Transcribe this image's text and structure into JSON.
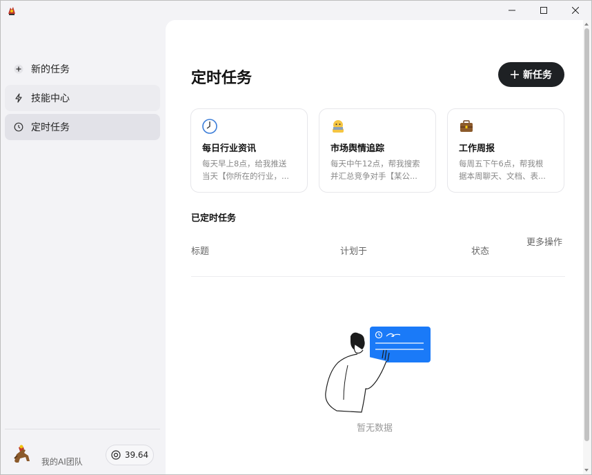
{
  "window": {
    "controls": [
      "minimize",
      "maximize",
      "close"
    ]
  },
  "sidebar": {
    "items": [
      {
        "label": "新的任务",
        "icon": "plus-icon"
      },
      {
        "label": "技能中心",
        "icon": "lightning-icon"
      },
      {
        "label": "定时任务",
        "icon": "clock-icon"
      }
    ],
    "footer": {
      "team_name": "我的AI团队",
      "credits": "39.64"
    }
  },
  "main": {
    "title": "定时任务",
    "new_task_label": "新任务",
    "templates": [
      {
        "icon": "clock-emoji-icon",
        "title": "每日行业资讯",
        "desc_line1": "每天早上8点，给我推送",
        "desc_line2": "当天【你所在的行业，..."
      },
      {
        "icon": "face-emoji-icon",
        "title": "市场舆情追踪",
        "desc_line1": "每天中午12点，帮我搜索",
        "desc_line2": "并汇总竞争对手【某公..."
      },
      {
        "icon": "briefcase-emoji-icon",
        "title": "工作周报",
        "desc_line1": "每周五下午6点，帮我根",
        "desc_line2": "据本周聊天、文档、表..."
      }
    ],
    "scheduled_section_title": "已定时任务",
    "table_headers": {
      "title": "标题",
      "planned": "计划于",
      "status": "状态",
      "more": "更多操作"
    },
    "empty_text": "暂无数据"
  }
}
